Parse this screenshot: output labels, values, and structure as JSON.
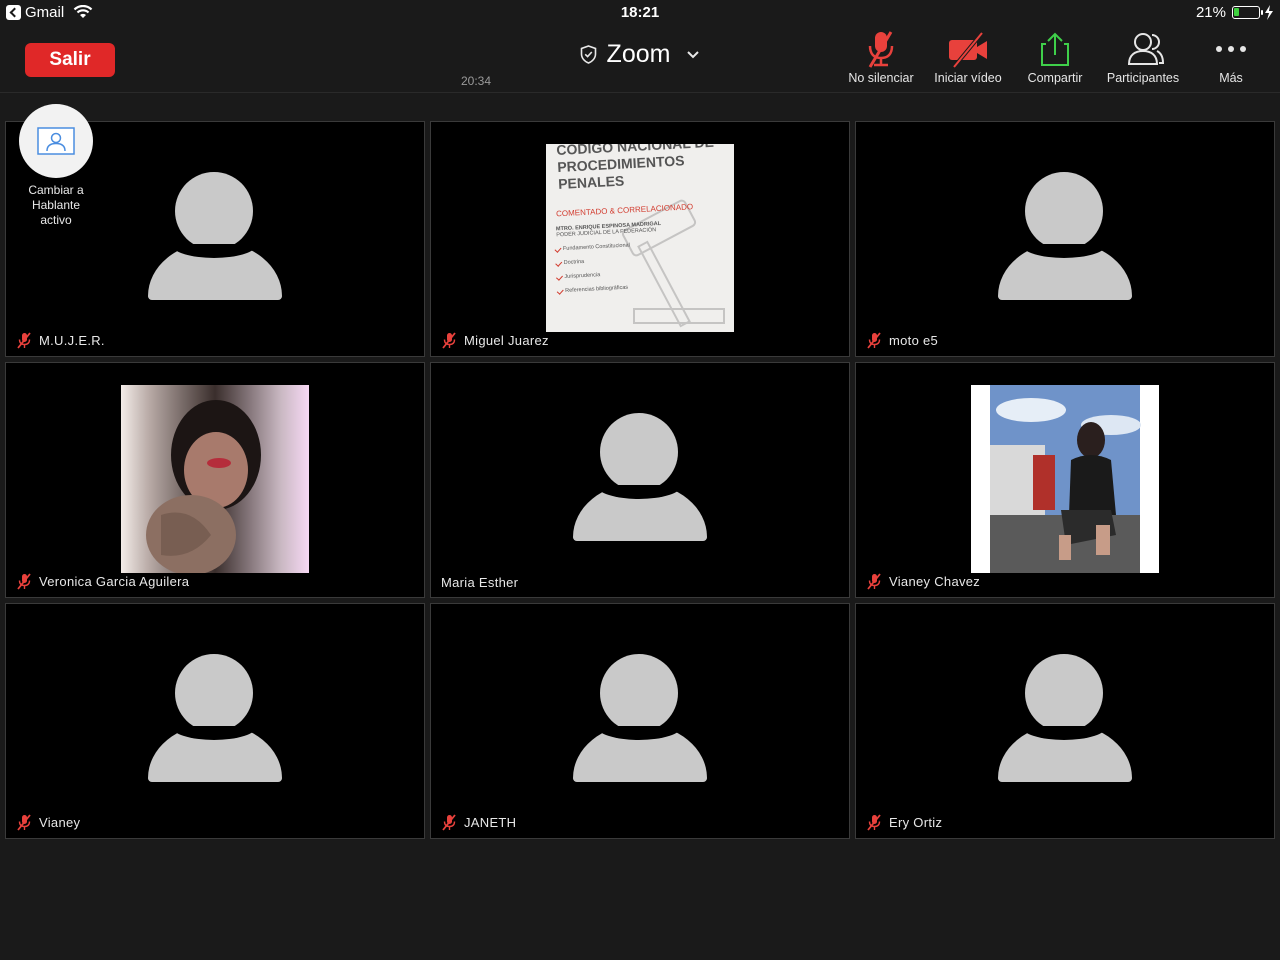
{
  "status_bar": {
    "app": "Gmail",
    "time": "18:21",
    "battery_pct": "21%",
    "battery_level": 0.21
  },
  "toolbar": {
    "leave_label": "Salir",
    "meeting_title": "Zoom",
    "meeting_timer": "20:34",
    "tools": [
      {
        "label": "No silenciar",
        "icon": "mic-muted-icon"
      },
      {
        "label": "Iniciar vídeo",
        "icon": "video-off-icon"
      },
      {
        "label": "Compartir",
        "icon": "share-icon"
      },
      {
        "label": "Participantes",
        "icon": "participants-icon"
      },
      {
        "label": "Más",
        "icon": "more-icon"
      }
    ]
  },
  "speaker_switch": {
    "label": "Cambiar a Hablante activo"
  },
  "book_cover": {
    "title": "CÓDIGO NACIONAL DE PROCEDIMIENTOS PENALES",
    "subtitle": "COMENTADO & CORRELACIONADO",
    "author": "MTRO. ENRIQUE ESPINOSA MADRIGAL",
    "author_role": "PODER JUDICIAL DE LA FEDERACIÓN",
    "items": [
      "Fundamento Constitucional",
      "Doctrina",
      "Jurisprudencia",
      "Referencias bibliográficas"
    ]
  },
  "participants": [
    {
      "name": "M.U.J.E.R.",
      "muted": true,
      "video": "avatar"
    },
    {
      "name": "Miguel Juarez",
      "muted": true,
      "video": "book"
    },
    {
      "name": "moto e5",
      "muted": true,
      "video": "avatar"
    },
    {
      "name": "Veronica Garcia Aguilera",
      "muted": true,
      "video": "photo"
    },
    {
      "name": "Maria Esther",
      "muted": false,
      "video": "avatar"
    },
    {
      "name": "Vianey Chavez",
      "muted": true,
      "video": "photo"
    },
    {
      "name": "Vianey",
      "muted": true,
      "video": "avatar"
    },
    {
      "name": "JANETH",
      "muted": true,
      "video": "avatar"
    },
    {
      "name": "Ery Ortiz",
      "muted": true,
      "video": "avatar"
    }
  ],
  "colors": {
    "leave": "#e02828",
    "muted": "#e8413c",
    "share": "#3fcf4a"
  }
}
